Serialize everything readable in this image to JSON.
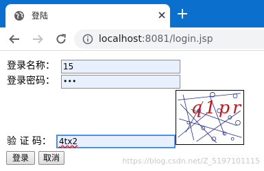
{
  "browser": {
    "tab_title": "登陆",
    "url_host": "localhost",
    "url_rest": ":8081/login.jsp"
  },
  "form": {
    "username_label": "登录名称：",
    "username_value": "15",
    "password_label": "登录密码：",
    "password_value": "•••",
    "captcha_label": "验 证 码：",
    "captcha_value": "4tx2",
    "captcha_image_text": "q1pr",
    "login_button": "登录",
    "cancel_button": "取消"
  },
  "watermark": "https://blog.csdn.net/Z_5197101115",
  "colors": {
    "tabstrip": "#0b6fce",
    "field_autofill": "#e8f0fe",
    "focus_border": "#4d8fe6",
    "captcha_text": "#c81414",
    "captcha_lines": "#1c2a8c"
  },
  "icons": {
    "favicon": "globe-icon",
    "close": "close-icon",
    "new_tab": "plus-icon",
    "back": "arrow-left-icon",
    "forward": "arrow-right-icon",
    "reload": "reload-icon",
    "site_info": "info-icon"
  }
}
